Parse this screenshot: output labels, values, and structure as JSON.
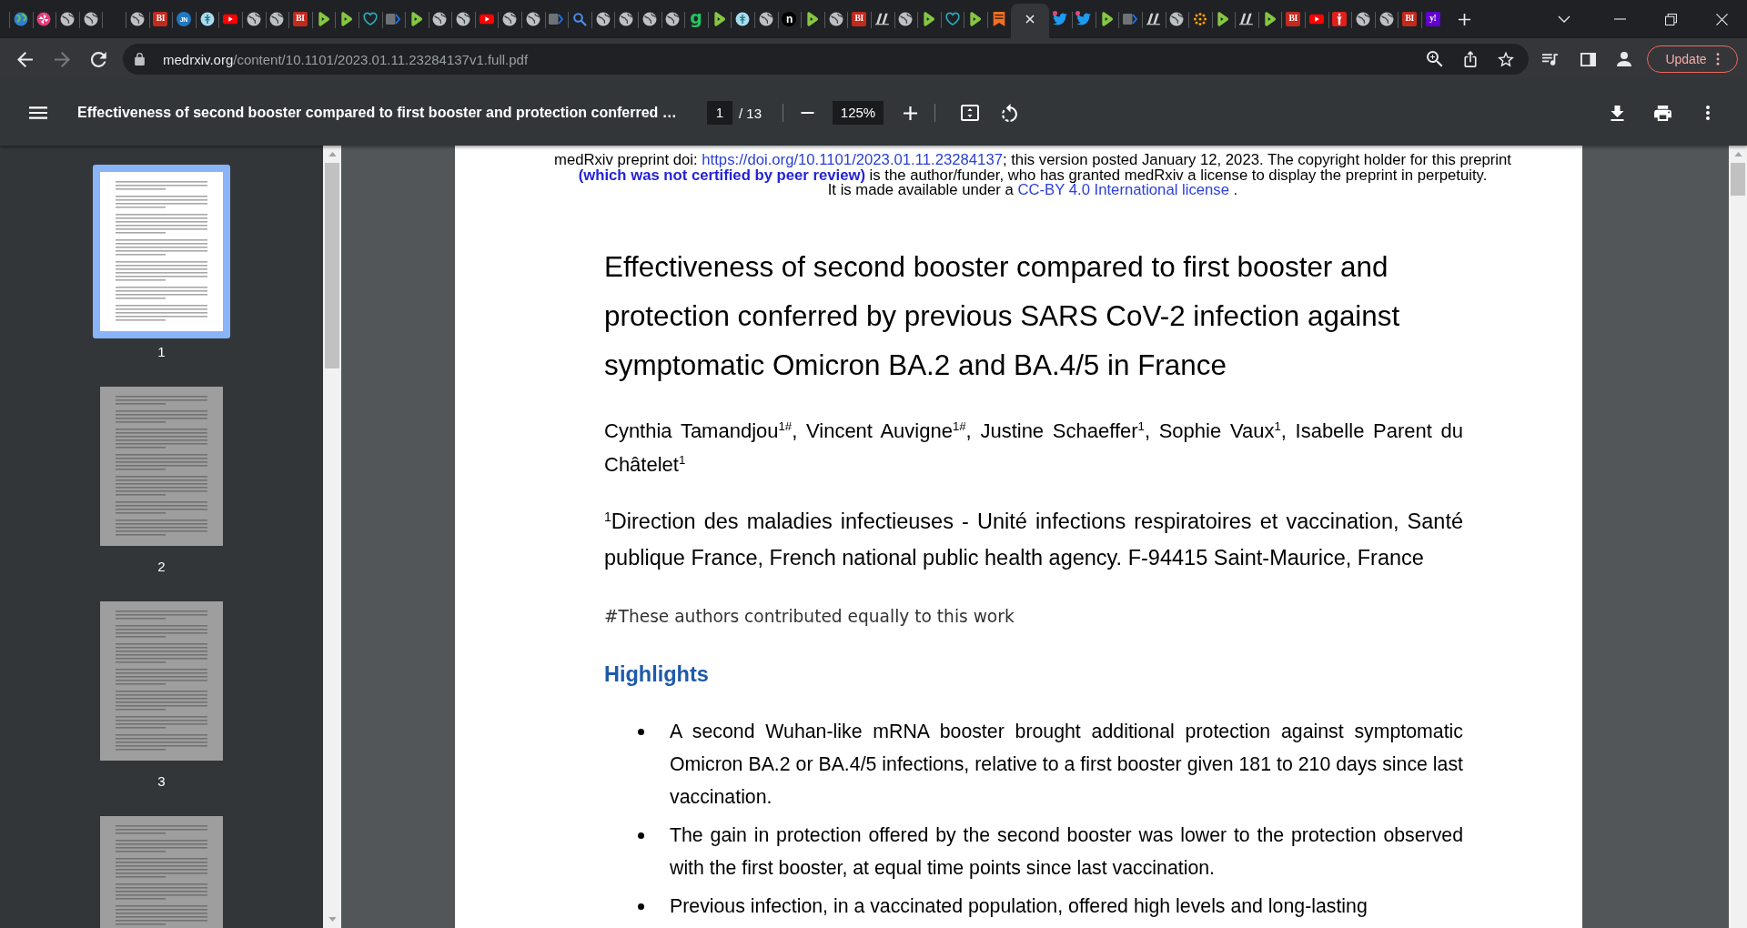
{
  "tabs": [
    {
      "kind": "earth",
      "selected": false,
      "alert": false
    },
    {
      "kind": "pinwheel",
      "selected": false,
      "alert": false
    },
    {
      "kind": "globe",
      "selected": false,
      "alert": false
    },
    {
      "kind": "globe",
      "selected": false,
      "alert": false
    },
    {
      "kind": "blank",
      "selected": false,
      "alert": false
    },
    {
      "kind": "globe",
      "selected": false,
      "alert": false
    },
    {
      "kind": "square",
      "label": "BI",
      "color": "#c4291d",
      "selected": false,
      "alert": false
    },
    {
      "kind": "circle",
      "label": "JN",
      "color": "#2079c3",
      "selected": false,
      "alert": false
    },
    {
      "kind": "medical",
      "selected": false,
      "alert": false
    },
    {
      "kind": "video",
      "selected": false,
      "alert": false
    },
    {
      "kind": "globe",
      "selected": false,
      "alert": false
    },
    {
      "kind": "globe",
      "selected": false,
      "alert": false
    },
    {
      "kind": "square",
      "label": "BI",
      "color": "#c4291d",
      "selected": false,
      "alert": false
    },
    {
      "kind": "play",
      "selected": false,
      "alert": false
    },
    {
      "kind": "play",
      "selected": false,
      "alert": false
    },
    {
      "kind": "heart",
      "selected": false,
      "alert": false
    },
    {
      "kind": "chevron",
      "selected": false,
      "alert": false
    },
    {
      "kind": "play",
      "selected": false,
      "alert": false
    },
    {
      "kind": "globe",
      "selected": false,
      "alert": false
    },
    {
      "kind": "globe",
      "selected": false,
      "alert": false
    },
    {
      "kind": "video",
      "selected": false,
      "alert": false
    },
    {
      "kind": "globe",
      "selected": false,
      "alert": false
    },
    {
      "kind": "globe",
      "selected": false,
      "alert": false
    },
    {
      "kind": "chevron",
      "selected": false,
      "alert": false
    },
    {
      "kind": "search",
      "selected": false,
      "alert": false
    },
    {
      "kind": "globe",
      "selected": false,
      "alert": false
    },
    {
      "kind": "globe",
      "selected": false,
      "alert": false
    },
    {
      "kind": "globe",
      "selected": false,
      "alert": false
    },
    {
      "kind": "globe",
      "selected": false,
      "alert": false
    },
    {
      "kind": "letter",
      "label": "g",
      "color": "#22c55e",
      "selected": false,
      "alert": false
    },
    {
      "kind": "play",
      "selected": false,
      "alert": false
    },
    {
      "kind": "medical",
      "selected": false,
      "alert": false
    },
    {
      "kind": "globe",
      "selected": false,
      "alert": false
    },
    {
      "kind": "circle",
      "label": "n",
      "color": "#000000",
      "selected": false,
      "alert": false
    },
    {
      "kind": "play",
      "selected": false,
      "alert": false
    },
    {
      "kind": "globe",
      "selected": false,
      "alert": false
    },
    {
      "kind": "square",
      "label": "BI",
      "color": "#c4291d",
      "selected": false,
      "alert": false
    },
    {
      "kind": "slanted",
      "selected": false,
      "alert": false
    },
    {
      "kind": "globe",
      "selected": false,
      "alert": false
    },
    {
      "kind": "play",
      "selected": false,
      "alert": false
    },
    {
      "kind": "heart",
      "selected": false,
      "alert": false
    },
    {
      "kind": "play",
      "selected": false,
      "alert": false
    },
    {
      "kind": "bookmark",
      "selected": false,
      "alert": false
    },
    {
      "kind": "blank",
      "selected": true,
      "alert": false
    },
    {
      "kind": "bird",
      "selected": false,
      "alert": true
    },
    {
      "kind": "bird",
      "selected": false,
      "alert": true
    },
    {
      "kind": "play",
      "selected": false,
      "alert": false
    },
    {
      "kind": "chevron",
      "selected": false,
      "alert": false
    },
    {
      "kind": "slanted",
      "selected": false,
      "alert": false
    },
    {
      "kind": "globe",
      "selected": false,
      "alert": false
    },
    {
      "kind": "sun",
      "selected": false,
      "alert": false
    },
    {
      "kind": "play",
      "selected": false,
      "alert": false
    },
    {
      "kind": "slanted",
      "selected": false,
      "alert": false
    },
    {
      "kind": "play",
      "selected": false,
      "alert": false
    },
    {
      "kind": "square",
      "label": "BI",
      "color": "#c4291d",
      "selected": false,
      "alert": false
    },
    {
      "kind": "video",
      "selected": false,
      "alert": false
    },
    {
      "kind": "torch",
      "selected": false,
      "alert": false
    },
    {
      "kind": "globe",
      "selected": false,
      "alert": false
    },
    {
      "kind": "globe",
      "selected": false,
      "alert": false
    },
    {
      "kind": "square",
      "label": "BI",
      "color": "#c4291d",
      "selected": false,
      "alert": false
    },
    {
      "kind": "square",
      "label": "y!",
      "color": "#6001d2",
      "selected": false,
      "alert": false
    }
  ],
  "navigation": {
    "back_disabled": false,
    "forward_disabled": true
  },
  "address_bar": {
    "host": "medrxiv.org",
    "path": "/content/10.1101/2023.01.11.23284137v1.full.pdf",
    "update_label": "Update"
  },
  "pdf_toolbar": {
    "title": "Effectiveness of second booster compared to first booster and protection conferred …",
    "page": "1",
    "page_total": "/ 13",
    "zoom": "125%"
  },
  "thumbnails": [
    {
      "label": "1",
      "selected": true
    },
    {
      "label": "2",
      "selected": false
    },
    {
      "label": "3",
      "selected": false
    },
    {
      "selected": false
    }
  ],
  "document": {
    "notice": [
      {
        "kind": "link_line",
        "before": "medRxiv preprint doi: ",
        "link": "https://doi.org/10.1101/2023.01.11.23284137",
        "after": "; this version posted January 12, 2023. The copyright holder for this preprint"
      },
      {
        "kind": "text_line",
        "text": "**(which was not certified by peer review)** is the author/funder, who has granted medRxiv a license to display the preprint in perpetuity."
      },
      {
        "kind": "link_line",
        "before": "It is made available under a ",
        "link": "CC-BY 4.0 International license",
        "after": " ."
      }
    ],
    "title": "Effectiveness of second booster compared to first booster and protection conferred by previous SARS CoV-2 infection against symptomatic Omicron BA.2 and BA.4/5 in France",
    "authors": "Cynthia Tamandjou$^{1#}$, Vincent Auvigne$^{1#}$, Justine Schaeffer$^{1}$, Sophie Vaux$^{1}$, Isabelle Parent du Châtelet$^{1}$",
    "affiliation": "$^{1}$Direction des maladies infectieuses - Unité infections respiratoires et vaccination, Santé publique France, French national public health agency. F-94415 Saint-Maurice, France",
    "footnote": "#These authors contributed equally to this work",
    "section_heading": "Highlights",
    "bullets": [
      "A second Wuhan-like mRNA booster brought additional protection against symptomatic Omicron BA.2 or BA.4/5 infections, relative to a first booster given 181 to 210 days since last vaccination.",
      "The gain in protection offered by the second booster was lower to the protection observed with the first booster, at equal time points since last vaccination.",
      "Previous infection, in a vaccinated population, offered high levels and long-lasting"
    ]
  }
}
